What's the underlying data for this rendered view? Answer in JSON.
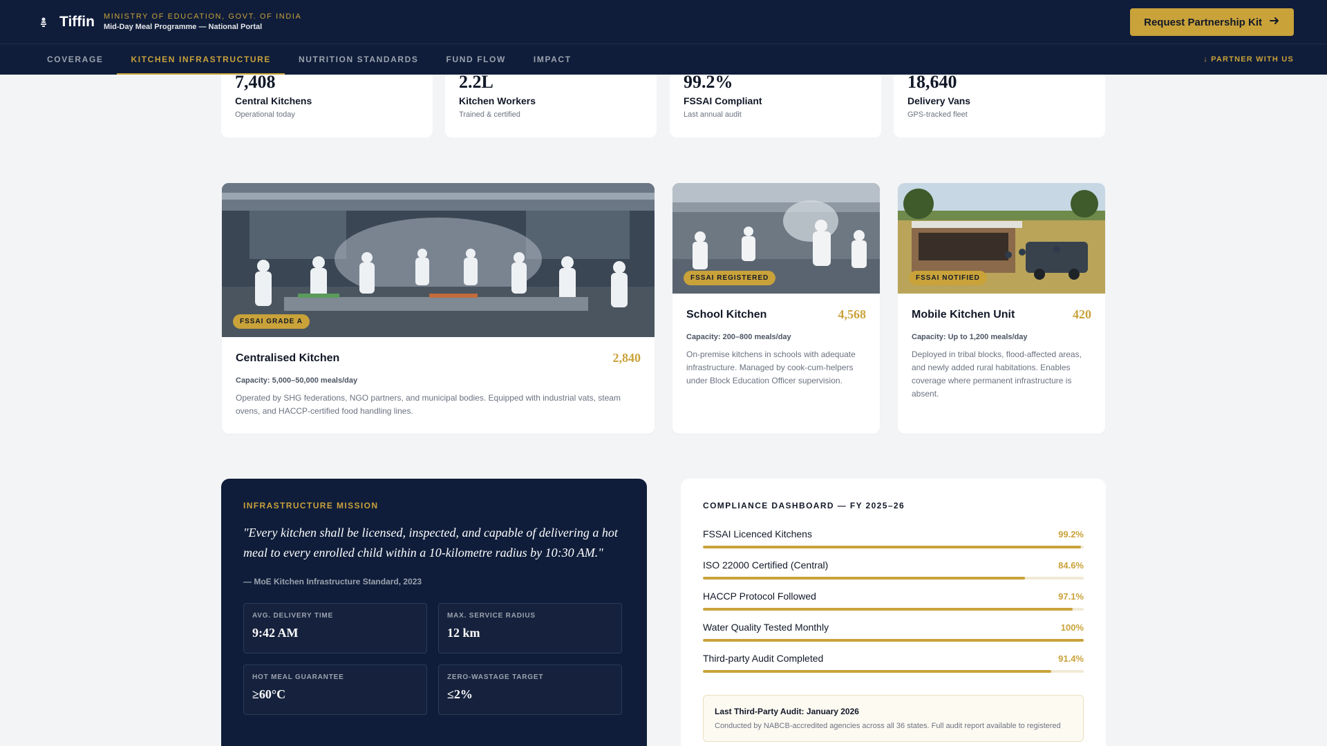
{
  "header": {
    "brand": "Tiffin",
    "ministry": "MINISTRY OF EDUCATION, GOVT. OF INDIA",
    "portal": "Mid-Day Meal Programme — National Portal",
    "cta_label": "Request Partnership Kit"
  },
  "nav": {
    "items": [
      {
        "label": "COVERAGE",
        "active": false
      },
      {
        "label": "KITCHEN INFRASTRUCTURE",
        "active": true
      },
      {
        "label": "NUTRITION STANDARDS",
        "active": false
      },
      {
        "label": "FUND FLOW",
        "active": false
      },
      {
        "label": "IMPACT",
        "active": false
      }
    ],
    "partner_link": "↓ PARTNER WITH US"
  },
  "stats": [
    {
      "value": "7,408",
      "label": "Central Kitchens",
      "sub": "Operational today"
    },
    {
      "value": "2.2L",
      "label": "Kitchen Workers",
      "sub": "Trained & certified"
    },
    {
      "value": "99.2%",
      "label": "FSSAI Compliant",
      "sub": "Last annual audit"
    },
    {
      "value": "18,640",
      "label": "Delivery Vans",
      "sub": "GPS-tracked fleet"
    }
  ],
  "kitchens": [
    {
      "badge": "FSSAI GRADE A",
      "title": "Centralised Kitchen",
      "count": "2,840",
      "capacity": "Capacity: 5,000–50,000 meals/day",
      "desc": "Operated by SHG federations, NGO partners, and municipal bodies. Equipped with industrial vats, steam ovens, and HACCP-certified food handling lines."
    },
    {
      "badge": "FSSAI REGISTERED",
      "title": "School Kitchen",
      "count": "4,568",
      "capacity": "Capacity: 200–800 meals/day",
      "desc": "On-premise kitchens in schools with adequate infrastructure. Managed by cook-cum-helpers under Block Education Officer supervision."
    },
    {
      "badge": "FSSAI NOTIFIED",
      "title": "Mobile Kitchen Unit",
      "count": "420",
      "capacity": "Capacity: Up to 1,200 meals/day",
      "desc": "Deployed in tribal blocks, flood-affected areas, and newly added rural habitations. Enables coverage where permanent infrastructure is absent."
    }
  ],
  "mission": {
    "eyebrow": "INFRASTRUCTURE MISSION",
    "quote": "\"Every kitchen shall be licensed, inspected, and capable of delivering a hot meal to every enrolled child within a 10-kilometre radius by 10:30 AM.\"",
    "source": "— MoE Kitchen Infrastructure Standard, 2023",
    "metrics": [
      {
        "label": "AVG. DELIVERY TIME",
        "value": "9:42 AM"
      },
      {
        "label": "MAX. SERVICE RADIUS",
        "value": "12 km"
      },
      {
        "label": "HOT MEAL GUARANTEE",
        "value": "≥60°C"
      },
      {
        "label": "ZERO-WASTAGE TARGET",
        "value": "≤2%"
      }
    ]
  },
  "compliance": {
    "title": "COMPLIANCE DASHBOARD — FY 2025–26",
    "rows": [
      {
        "label": "FSSAI Licenced Kitchens",
        "pct": "99.2%",
        "value": 99.2
      },
      {
        "label": "ISO 22000 Certified (Central)",
        "pct": "84.6%",
        "value": 84.6
      },
      {
        "label": "HACCP Protocol Followed",
        "pct": "97.1%",
        "value": 97.1
      },
      {
        "label": "Water Quality Tested Monthly",
        "pct": "100%",
        "value": 100
      },
      {
        "label": "Third-party Audit Completed",
        "pct": "91.4%",
        "value": 91.4
      }
    ],
    "audit_title": "Last Third-Party Audit: January 2026",
    "audit_text": "Conducted by NABCB-accredited agencies across all 36 states. Full audit report available to registered"
  },
  "colors": {
    "navy": "#0f1d3a",
    "gold": "#c9a23a"
  }
}
